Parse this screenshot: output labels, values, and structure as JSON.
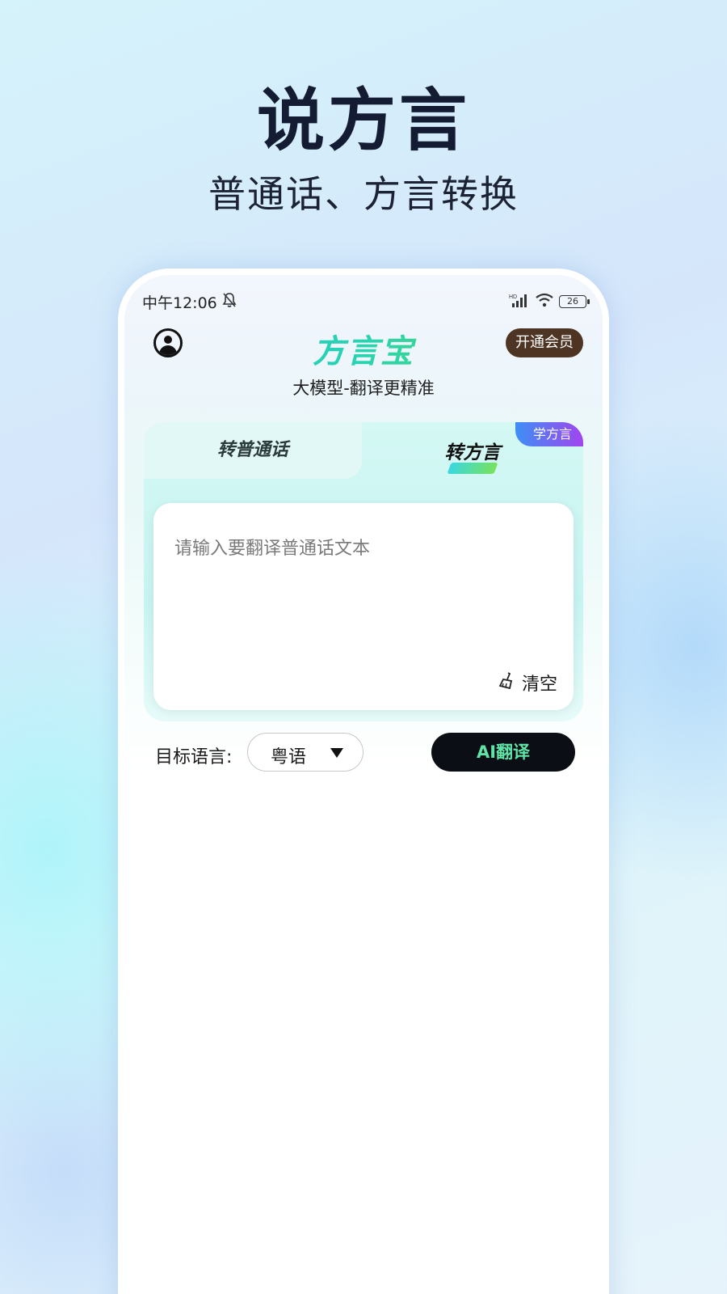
{
  "promo": {
    "title": "说方言",
    "subtitle": "普通话、方言转换"
  },
  "status_bar": {
    "time": "中午12:06",
    "mute_icon": "bell-off-icon",
    "network_label": "HD",
    "signal_icon": "signal-icon",
    "wifi_icon": "wifi-icon",
    "battery": "26"
  },
  "header": {
    "user_icon": "user-icon",
    "logo": "方言宝",
    "vip_label": "开通会员"
  },
  "tagline": "大模型-翻译更精准",
  "tabs": [
    {
      "label": "转普通话",
      "active": false
    },
    {
      "label": "转方言",
      "active": true
    }
  ],
  "learn_badge": "学方言",
  "input": {
    "placeholder": "请输入要翻译普通话文本",
    "value": ""
  },
  "clear": {
    "icon": "broom-icon",
    "label": "清空"
  },
  "target": {
    "label": "目标语言:",
    "selected": "粤语"
  },
  "translate_button": "AI翻译",
  "colors": {
    "accent_gradient_start": "#19c6d6",
    "accent_gradient_end": "#59d64a",
    "vip_bg": "#4e3423",
    "button_bg": "#0b0f15",
    "button_text": "#5fe3a6"
  }
}
